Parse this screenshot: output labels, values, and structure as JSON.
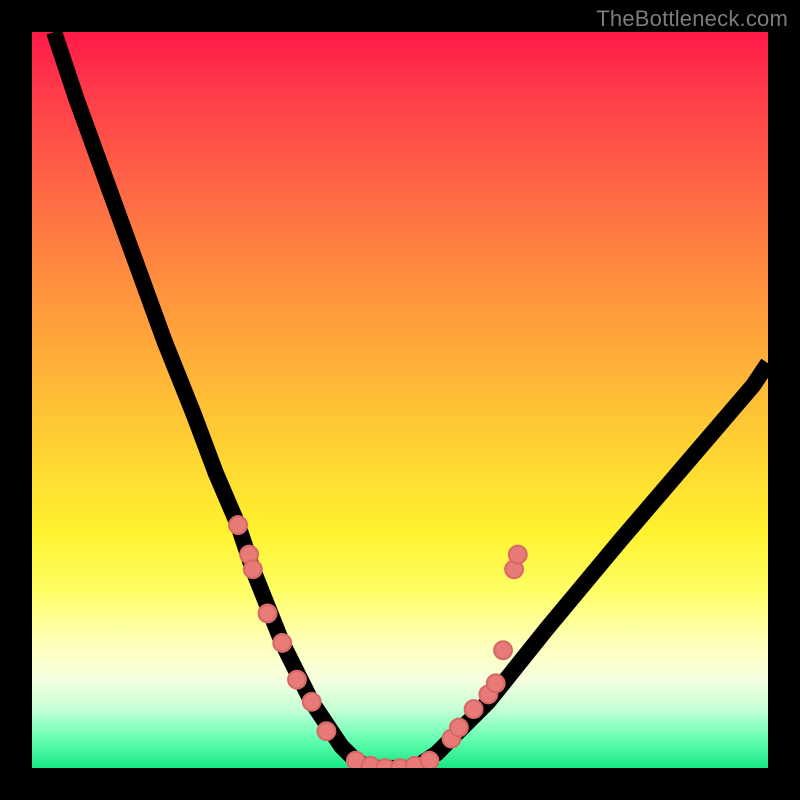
{
  "watermark": "TheBottleneck.com",
  "chart_data": {
    "type": "line",
    "title": "",
    "xlabel": "",
    "ylabel": "",
    "xlim": [
      0,
      100
    ],
    "ylim": [
      0,
      100
    ],
    "series": [
      {
        "name": "bottleneck-curve",
        "x": [
          3,
          6,
          10,
          14,
          18,
          22,
          25,
          28,
          30,
          32,
          34,
          36,
          38,
          40,
          42,
          44,
          46,
          48,
          50,
          52,
          55,
          58,
          62,
          66,
          70,
          75,
          80,
          86,
          92,
          98,
          100
        ],
        "y": [
          100,
          91,
          80,
          69,
          58,
          48,
          40,
          33,
          27,
          22,
          17,
          13,
          9,
          6,
          3,
          1,
          0,
          0,
          0,
          0,
          2,
          5,
          9,
          14,
          19,
          25,
          31,
          38,
          45,
          52,
          55
        ]
      }
    ],
    "markers": [
      {
        "x": 28,
        "y": 33
      },
      {
        "x": 29.5,
        "y": 29
      },
      {
        "x": 30,
        "y": 27
      },
      {
        "x": 32,
        "y": 21
      },
      {
        "x": 34,
        "y": 17
      },
      {
        "x": 36,
        "y": 12
      },
      {
        "x": 38,
        "y": 9
      },
      {
        "x": 40,
        "y": 5
      },
      {
        "x": 44,
        "y": 1
      },
      {
        "x": 46,
        "y": 0.3
      },
      {
        "x": 48,
        "y": 0.0
      },
      {
        "x": 50,
        "y": 0.0
      },
      {
        "x": 52,
        "y": 0.3
      },
      {
        "x": 54,
        "y": 1
      },
      {
        "x": 57,
        "y": 4
      },
      {
        "x": 58,
        "y": 5.5
      },
      {
        "x": 60,
        "y": 8
      },
      {
        "x": 62,
        "y": 10
      },
      {
        "x": 63,
        "y": 11.5
      },
      {
        "x": 64,
        "y": 16
      },
      {
        "x": 65.5,
        "y": 27
      },
      {
        "x": 66,
        "y": 29
      }
    ],
    "marker_radius_pct": 1.2,
    "annotations": []
  },
  "colors": {
    "background": "#000000",
    "curve": "#000000",
    "marker": "#e87b78",
    "watermark": "#7c7c7c"
  }
}
